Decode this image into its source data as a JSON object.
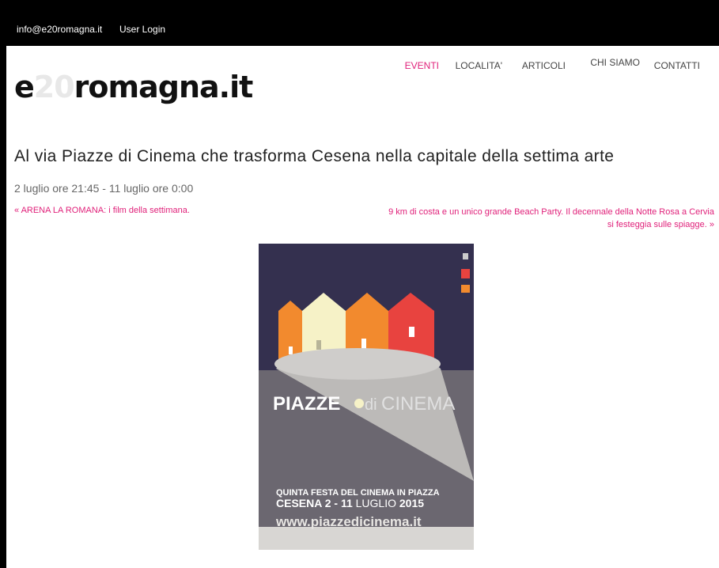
{
  "topbar": {
    "email": "info@e20romagna.it",
    "login": "User Login"
  },
  "logo": {
    "part1": "e",
    "part2": "20",
    "part3": "romagna.it"
  },
  "nav": {
    "items": [
      "EVENTI",
      "LOCALITA'",
      "ARTICOLI",
      "CHI SIAMO",
      "CONTATTI"
    ],
    "active_color": "#e0217a"
  },
  "article": {
    "title": "Al via Piazze di Cinema che trasforma Cesena nella capitale della settima arte",
    "date": "2 luglio ore 21:45 - 11 luglio ore 0:00",
    "prev_link": "« ARENA LA ROMANA: i film della settimana.",
    "next_link": "9 km di costa e un unico grande Beach Party. Il decennale della Notte Rosa a Cervia si festeggia sulle spiagge. »"
  },
  "poster": {
    "title_left": "PIAZZE",
    "title_mid": "di",
    "title_right": "CINEMA",
    "line1": "QUINTA FESTA DEL CINEMA IN PIAZZA",
    "line2a": "CESENA 2 - 11 ",
    "line2b": "LUGLIO",
    "line2c": " 2015",
    "url": "www.piazzedicinema.it",
    "colors": {
      "top_bg": "#34304f",
      "mid_bg": "#6b6770",
      "bottom_bg": "#d8d6d3",
      "orange": "#f28a2e",
      "cream": "#f6f2c7",
      "red": "#e8433f"
    }
  }
}
